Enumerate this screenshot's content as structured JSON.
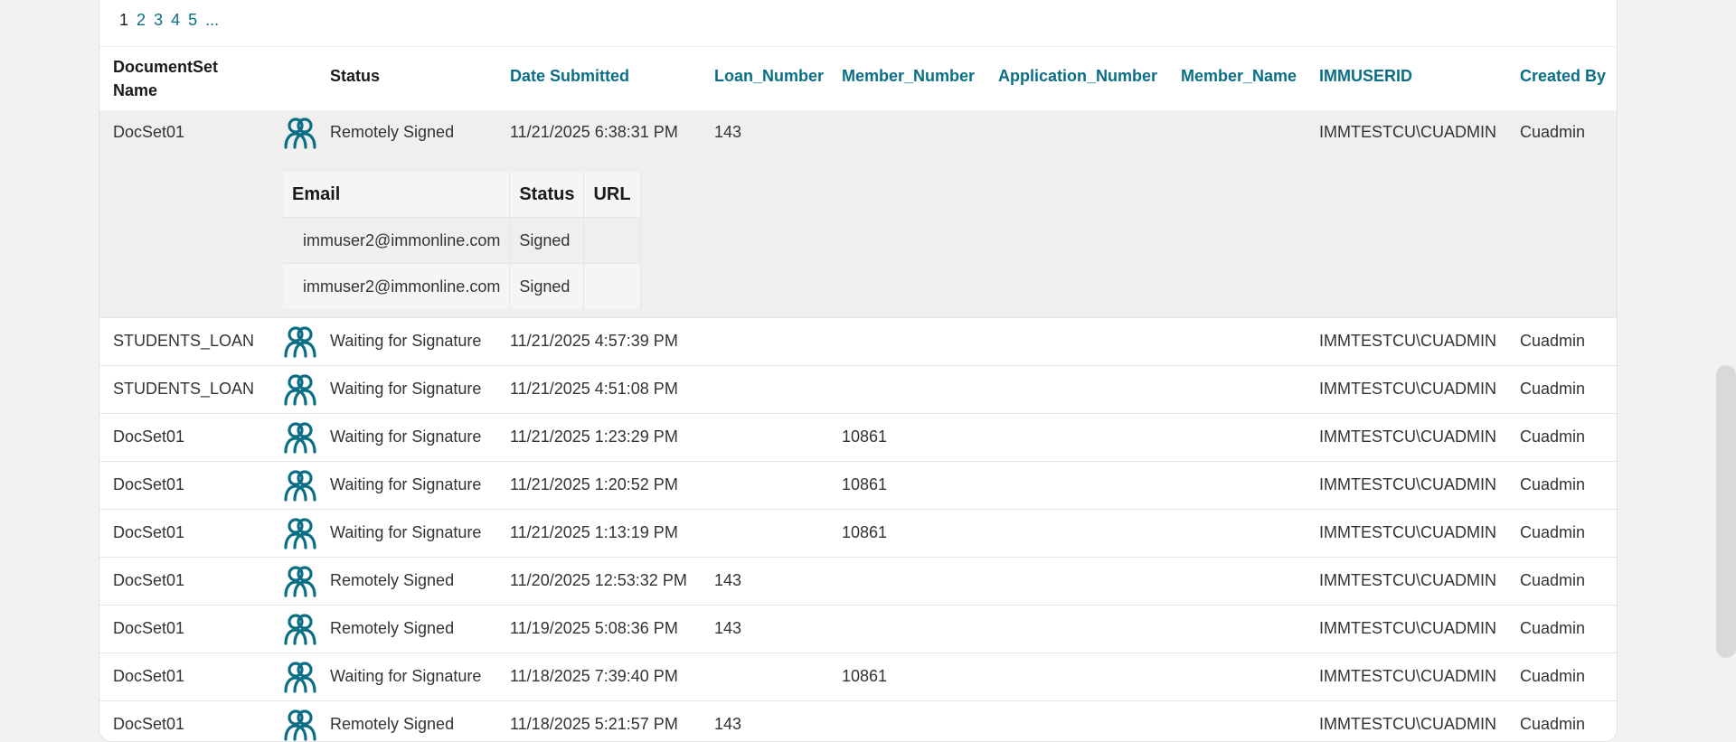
{
  "pagination": [
    "1",
    "2",
    "3",
    "4",
    "5",
    "..."
  ],
  "columns": {
    "docset": "DocumentSet Name",
    "status": "Status",
    "date": "Date Submitted",
    "loan": "Loan_Number",
    "member": "Member_Number",
    "app": "Application_Number",
    "member_name": "Member_Name",
    "immuserid": "IMMUSERID",
    "created_by": "Created By"
  },
  "rows": [
    {
      "docset": "DocSet01",
      "status": "Remotely Signed",
      "date": "11/21/2025 6:38:31 PM",
      "loan": "143",
      "member": "",
      "userid": "IMMTESTCU\\CUADMIN",
      "created": "Cuadmin"
    },
    {
      "docset": "STUDENTS_LOAN",
      "status": "Waiting for Signature",
      "date": "11/21/2025 4:57:39 PM",
      "loan": "",
      "member": "",
      "userid": "IMMTESTCU\\CUADMIN",
      "created": "Cuadmin"
    },
    {
      "docset": "STUDENTS_LOAN",
      "status": "Waiting for Signature",
      "date": "11/21/2025 4:51:08 PM",
      "loan": "",
      "member": "",
      "userid": "IMMTESTCU\\CUADMIN",
      "created": "Cuadmin"
    },
    {
      "docset": "DocSet01",
      "status": "Waiting for Signature",
      "date": "11/21/2025 1:23:29 PM",
      "loan": "",
      "member": "10861",
      "userid": "IMMTESTCU\\CUADMIN",
      "created": "Cuadmin"
    },
    {
      "docset": "DocSet01",
      "status": "Waiting for Signature",
      "date": "11/21/2025 1:20:52 PM",
      "loan": "",
      "member": "10861",
      "userid": "IMMTESTCU\\CUADMIN",
      "created": "Cuadmin"
    },
    {
      "docset": "DocSet01",
      "status": "Waiting for Signature",
      "date": "11/21/2025 1:13:19 PM",
      "loan": "",
      "member": "10861",
      "userid": "IMMTESTCU\\CUADMIN",
      "created": "Cuadmin"
    },
    {
      "docset": "DocSet01",
      "status": "Remotely Signed",
      "date": "11/20/2025 12:53:32 PM",
      "loan": "143",
      "member": "",
      "userid": "IMMTESTCU\\CUADMIN",
      "created": "Cuadmin"
    },
    {
      "docset": "DocSet01",
      "status": "Remotely Signed",
      "date": "11/19/2025 5:08:36 PM",
      "loan": "143",
      "member": "",
      "userid": "IMMTESTCU\\CUADMIN",
      "created": "Cuadmin"
    },
    {
      "docset": "DocSet01",
      "status": "Waiting for Signature",
      "date": "11/18/2025 7:39:40 PM",
      "loan": "",
      "member": "10861",
      "userid": "IMMTESTCU\\CUADMIN",
      "created": "Cuadmin"
    },
    {
      "docset": "DocSet01",
      "status": "Remotely Signed",
      "date": "11/18/2025 5:21:57 PM",
      "loan": "143",
      "member": "",
      "userid": "IMMTESTCU\\CUADMIN",
      "created": "Cuadmin"
    }
  ],
  "signers": {
    "headers": [
      "Email",
      "Status",
      "URL"
    ],
    "rows": [
      {
        "email": "immuser2@immonline.com",
        "status": "Signed",
        "url": ""
      },
      {
        "email": "immuser2@immonline.com",
        "status": "Signed",
        "url": ""
      }
    ]
  },
  "icon": "signers-icon",
  "accent": "#0a6f86"
}
